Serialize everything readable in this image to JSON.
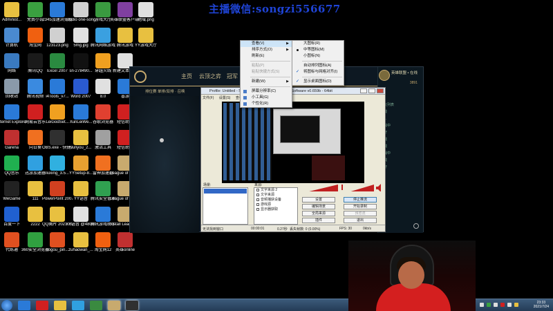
{
  "watermark": "主播微信:songzi556677",
  "desktop_icons": [
    {
      "label": "Administ...",
      "color": "#e8c040"
    },
    {
      "label": "计算机",
      "color": "#4a8ad0"
    },
    {
      "label": "网络",
      "color": "#3a7ac0"
    },
    {
      "label": "回收站",
      "color": "#8a9aaa"
    },
    {
      "label": "Internet Explorer",
      "color": "#2a7ad8"
    },
    {
      "label": "Garena",
      "color": "#c03030"
    },
    {
      "label": "QQ音乐",
      "color": "#20b050"
    },
    {
      "label": "WeGame",
      "color": "#222222"
    },
    {
      "label": "百度一下",
      "color": "#2060d0"
    },
    {
      "label": "代练通",
      "color": "#e05020"
    },
    {
      "label": "免费小说",
      "color": "#3aa040"
    },
    {
      "label": "淘宝网",
      "color": "#f06010"
    },
    {
      "label": "腾讯QQ",
      "color": "#1a1a1a"
    },
    {
      "label": "腾讯视频",
      "color": "#3a8ae0"
    },
    {
      "label": "网易云音乐",
      "color": "#d02020"
    },
    {
      "label": "向日葵",
      "color": "#f07020"
    },
    {
      "label": "迅游加速器",
      "color": "#30a0e0"
    },
    {
      "label": "111",
      "color": "#e8c040"
    },
    {
      "label": "2222",
      "color": "#e8c040"
    },
    {
      "label": "360安全浏览器",
      "color": "#30a040"
    },
    {
      "label": "2345加速浏览器",
      "color": "#2a7ad8"
    },
    {
      "label": "123123.png",
      "color": "#d0d0d0"
    },
    {
      "label": "Excel 2007",
      "color": "#2a8a40"
    },
    {
      "label": "i4Tools_v7...",
      "color": "#2a7ad8"
    },
    {
      "label": "LeiGodSet...",
      "color": "#f0a020"
    },
    {
      "label": "OBS.exe - 快捷方式",
      "color": "#303030"
    },
    {
      "label": "liuxing_3.5...",
      "color": "#30b0e0"
    },
    {
      "label": "PowerPoint 2007",
      "color": "#d04020"
    },
    {
      "label": "QQ图片 20210310...",
      "color": "#e8c040"
    },
    {
      "label": "sogou_pin...",
      "color": "#e05020"
    },
    {
      "label": "studio one-song",
      "color": "#d0d0d0"
    },
    {
      "label": "5mg.jpg",
      "color": "#e0e0e0"
    },
    {
      "label": "sn-278490...",
      "color": "#111111"
    },
    {
      "label": "Word 2007",
      "color": "#2a5ad0"
    },
    {
      "label": "XunLeiWe...",
      "color": "#2a7ad8"
    },
    {
      "label": "sunyou_2...",
      "color": "#e8c040"
    },
    {
      "label": "YYSetup-8...",
      "color": "#e8a030"
    },
    {
      "label": "YY语音",
      "color": "#e8c040"
    },
    {
      "label": "YY语音 @480006...",
      "color": "#e0e0e0"
    },
    {
      "label": "zuhaowan_...",
      "color": "#e8c040"
    },
    {
      "label": "游戏大厅",
      "color": "#3a9a40"
    },
    {
      "label": "腾讯网络游戏",
      "color": "#3aa0e0"
    },
    {
      "label": "穿越火线",
      "color": "#f0a020"
    },
    {
      "label": "8.0",
      "color": "#e0e0e0"
    },
    {
      "label": "谷歌浏览器",
      "color": "#e04030"
    },
    {
      "label": "激活工具",
      "color": "#a0a0a0"
    },
    {
      "label": "雷神加速器",
      "color": "#f07020"
    },
    {
      "label": "腾讯安全管家",
      "color": "#30a050"
    },
    {
      "label": "腾讯游戏助手",
      "color": "#2a7ad8"
    },
    {
      "label": "淘宝网12",
      "color": "#f06010"
    },
    {
      "label": "英雄联盟客户端.zip",
      "color": "#8040a0"
    },
    {
      "label": "腾讯游戏",
      "color": "#e8c040"
    },
    {
      "label": "新建文本文档",
      "color": "#e0e0e0"
    },
    {
      "label": "喜游",
      "color": "#2a7ad8"
    },
    {
      "label": "短信助手",
      "color": "#d02020"
    },
    {
      "label": "短信助手",
      "color": "#d02020"
    },
    {
      "label": "League of Legends",
      "color": "#c8aa6e"
    },
    {
      "label": "League of Legends",
      "color": "#c8aa6e"
    },
    {
      "label": "Install League ...",
      "color": "#c8aa6e"
    },
    {
      "label": "英雄online",
      "color": "#c03030"
    },
    {
      "label": "地域.png",
      "color": "#e0e0e0"
    },
    {
      "label": "YY游戏大厅",
      "color": "#e8c040"
    }
  ],
  "lol": {
    "nav": [
      "主页",
      "云顶之弈",
      "冠军"
    ],
    "sub": "排位赛 单排/双排 · 召唤",
    "username": "英雄联盟 • 在线",
    "points": "3891",
    "friends": [
      "好友列表",
      "在线",
      "Lv.1",
      "游戏中",
      "离开",
      "在线",
      "离线",
      "游戏中",
      "在线",
      "离开"
    ]
  },
  "obs": {
    "title": "Profile: Untitled - Scenes: Untitled - Broadcaster Software v0.659b - 64bit",
    "menu": [
      "文件(F)",
      "设置(S)",
      "查看(V)"
    ],
    "scenes_label": "场景:",
    "sources_label": "来源:",
    "sources": [
      "文字来源 2",
      "文字来源",
      "音频捕获设备",
      "游戏源",
      "显示器获取"
    ],
    "buttons_left": [
      "设置",
      "编辑场景",
      "全局来源",
      "插件"
    ],
    "buttons_right": [
      "停止推流",
      "开始录制",
      "预览流",
      "退出"
    ],
    "status": [
      "无法找到窗口",
      "00:00:01",
      "0.27秒",
      "丢失帧数: 0 (0.00%)",
      "FPS: 30",
      "0kb/s"
    ]
  },
  "context_menu": {
    "items": [
      {
        "label": "查看(V)",
        "submenu": true,
        "hover": true
      },
      {
        "label": "排序方式(O)",
        "submenu": true
      },
      {
        "label": "刷新(E)"
      },
      {
        "sep": true
      },
      {
        "label": "粘贴(P)",
        "disabled": true
      },
      {
        "label": "粘贴快捷方式(S)",
        "disabled": true
      },
      {
        "sep": true
      },
      {
        "label": "新建(W)",
        "submenu": true
      },
      {
        "sep": true
      },
      {
        "label": "屏幕分辨率(C)"
      },
      {
        "label": "小工具(G)"
      },
      {
        "label": "个性化(R)"
      }
    ]
  },
  "view_submenu": {
    "items": [
      {
        "label": "大图标(R)"
      },
      {
        "label": "中等图标(M)",
        "radio": true
      },
      {
        "label": "小图标(N)"
      },
      {
        "sep": true
      },
      {
        "label": "自动排列图标(A)"
      },
      {
        "label": "将图标与网格对齐(I)",
        "checked": true
      },
      {
        "sep": true
      },
      {
        "label": "显示桌面图标(D)",
        "checked": true
      }
    ]
  },
  "taskbar": {
    "time": "23:33",
    "date": "2021/7/24",
    "apps": [
      "ie",
      "netease-music",
      "folder",
      "media",
      "lol-client",
      "obs"
    ]
  }
}
